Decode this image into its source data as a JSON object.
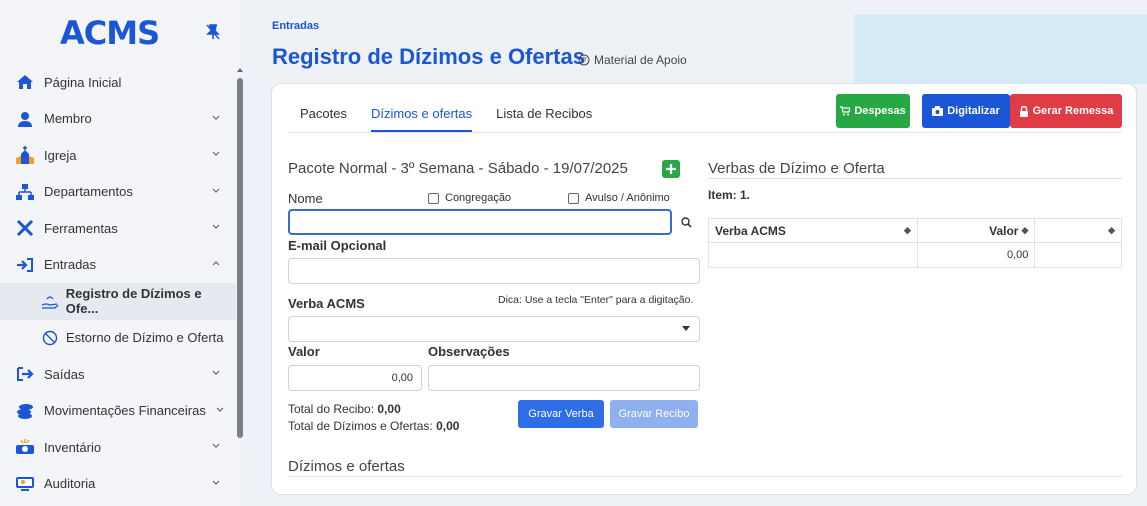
{
  "sidebar": {
    "logo": "ACMS",
    "items": [
      {
        "label": "Página Inicial",
        "icon": "home-icon"
      },
      {
        "label": "Membro",
        "icon": "person-icon"
      },
      {
        "label": "Igreja",
        "icon": "church-icon"
      },
      {
        "label": "Departamentos",
        "icon": "sitemap-icon"
      },
      {
        "label": "Ferramentas",
        "icon": "tools-icon"
      },
      {
        "label": "Entradas",
        "icon": "sign-in-icon"
      },
      {
        "label": "Saídas",
        "icon": "sign-out-icon"
      },
      {
        "label": "Movimentações Financeiras",
        "icon": "coins-icon"
      },
      {
        "label": "Inventário",
        "icon": "inventory-icon"
      },
      {
        "label": "Auditoria",
        "icon": "audit-icon"
      }
    ],
    "subitems": [
      {
        "label": "Registro de Dízimos e Ofe...",
        "icon": "hand-money-icon"
      },
      {
        "label": "Estorno de Dízimo e Oferta",
        "icon": "ban-icon"
      }
    ]
  },
  "header": {
    "breadcrumb": "Entradas",
    "title": "Registro de Dízimos e Ofertas",
    "help": "Material de Apoio"
  },
  "tabs": [
    "Pacotes",
    "Dízimos e ofertas",
    "Lista de Recibos"
  ],
  "actions": {
    "despesas": "Despesas",
    "digitalizar": "Digitalizar",
    "gerar": "Gerar Remessa"
  },
  "form": {
    "pacote_title": "Pacote Normal - 3º Semana - Sábado - 19/07/2025",
    "nome_label": "Nome",
    "congregacao_label": "Congregação",
    "avulso_label": "Avulso / Anônimo",
    "nome_value": "",
    "email_label": "E-mail Opcional",
    "email_value": "",
    "verba_label": "Verba ACMS",
    "hint": "Dica: Use a tecla \"Enter\" para a digitação.",
    "verba_value": "",
    "valor_label": "Valor",
    "valor_value": "0,00",
    "obs_label": "Observações",
    "obs_value": "",
    "total_recibo_label": "Total do Recibo:",
    "total_recibo_value": "0,00",
    "total_dizimos_label": "Total de Dízimos e Ofertas:",
    "total_dizimos_value": "0,00",
    "gravar_verba": "Gravar Verba",
    "gravar_recibo": "Gravar Recibo",
    "section_title": "Dízimos e ofertas"
  },
  "verbas": {
    "title": "Verbas de Dízimo e Oferta",
    "item_count": "Item: 1.",
    "columns": [
      "Verba ACMS",
      "Valor",
      ""
    ],
    "rows": [
      [
        "",
        "0,00",
        ""
      ]
    ]
  },
  "colors": {
    "primary": "#1a56d6",
    "success": "#28a745",
    "danger": "#e03c45",
    "panel": "#d6ebf8"
  }
}
